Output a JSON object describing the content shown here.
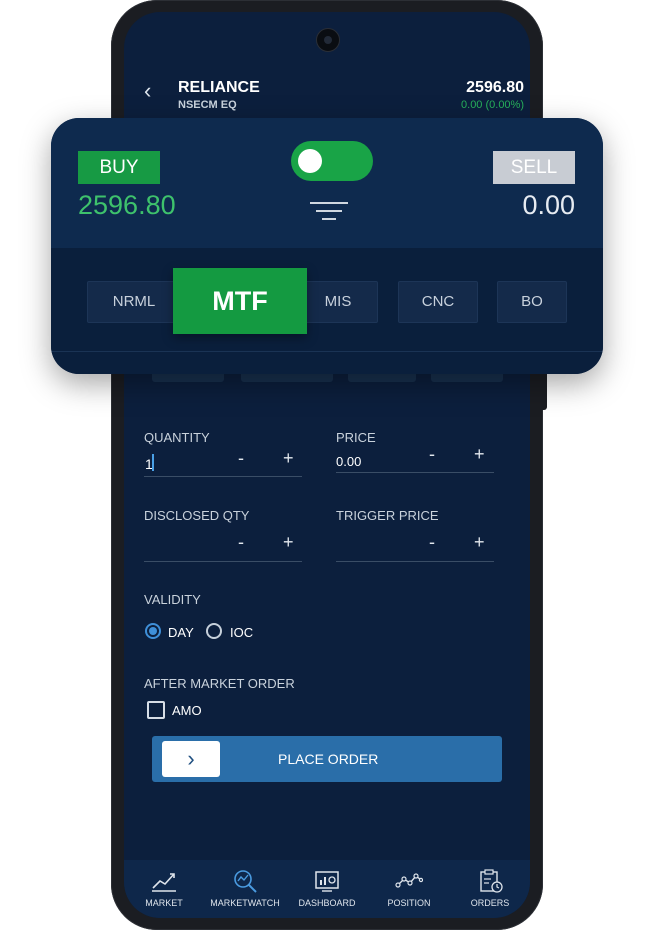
{
  "header": {
    "symbol": "RELIANCE",
    "exchange": "NSECM EQ",
    "ltp": "2596.80",
    "change": "0.00 (0.00%)"
  },
  "order_card": {
    "buy_label": "BUY",
    "buy_price": "2596.80",
    "sell_label": "SELL",
    "sell_price": "0.00",
    "toggle_on": true
  },
  "product_types": [
    "NRML",
    "MTF",
    "MIS",
    "CNC",
    "BO"
  ],
  "active_product": "MTF",
  "form": {
    "quantity_label": "QUANTITY",
    "quantity_value": "1",
    "price_label": "PRICE",
    "price_value": "0.00",
    "disclosed_label": "DISCLOSED QTY",
    "trigger_label": "TRIGGER PRICE",
    "minus": "-",
    "plus": "+"
  },
  "validity": {
    "label": "VALIDITY",
    "options": [
      "DAY",
      "IOC"
    ],
    "selected": "DAY"
  },
  "amo": {
    "label": "AFTER MARKET ORDER",
    "option": "AMO",
    "checked": false
  },
  "place_order": {
    "label": "PLACE ORDER",
    "arrow": "›"
  },
  "bottom_nav": [
    {
      "label": "MARKET",
      "icon": "chart-line-icon"
    },
    {
      "label": "MARKETWATCH",
      "icon": "magnifier-chart-icon"
    },
    {
      "label": "DASHBOARD",
      "icon": "dashboard-icon"
    },
    {
      "label": "POSITION",
      "icon": "position-graph-icon"
    },
    {
      "label": "ORDERS",
      "icon": "orders-clipboard-icon"
    }
  ],
  "colors": {
    "buy_green": "#179a44",
    "price_green": "#3ec26c",
    "screen_bg": "#0c1f3d",
    "accent_blue": "#2a6ea9"
  }
}
